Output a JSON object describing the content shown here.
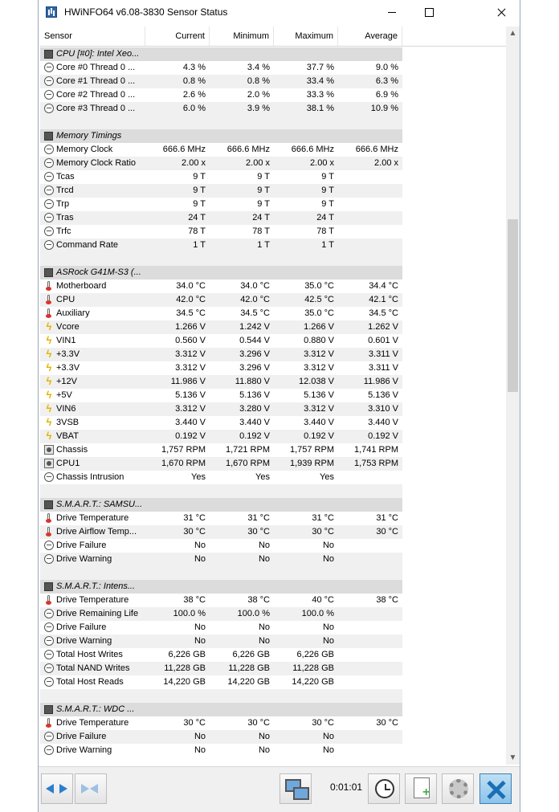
{
  "window": {
    "title": "HWiNFO64 v6.08-3830 Sensor Status"
  },
  "columns": {
    "sensor": "Sensor",
    "current": "Current",
    "minimum": "Minimum",
    "maximum": "Maximum",
    "average": "Average"
  },
  "rows": [
    {
      "kind": "group",
      "name": "CPU [#0]: Intel Xeo...",
      "icon": "chip-icon"
    },
    {
      "kind": "item",
      "icon": "clock-icon",
      "name": "Core #0 Thread 0 ...",
      "current": "4.3 %",
      "min": "3.4 %",
      "max": "37.7 %",
      "avg": "9.0 %"
    },
    {
      "kind": "item",
      "icon": "clock-icon",
      "name": "Core #1 Thread 0 ...",
      "current": "0.8 %",
      "min": "0.8 %",
      "max": "33.4 %",
      "avg": "6.3 %"
    },
    {
      "kind": "item",
      "icon": "clock-icon",
      "name": "Core #2 Thread 0 ...",
      "current": "2.6 %",
      "min": "2.0 %",
      "max": "33.3 %",
      "avg": "6.9 %"
    },
    {
      "kind": "item",
      "icon": "clock-icon",
      "name": "Core #3 Thread 0 ...",
      "current": "6.0 %",
      "min": "3.9 %",
      "max": "38.1 %",
      "avg": "10.9 %"
    },
    {
      "kind": "spacer"
    },
    {
      "kind": "group",
      "name": "Memory Timings",
      "icon": "chip-icon"
    },
    {
      "kind": "item",
      "icon": "clock-icon",
      "name": "Memory Clock",
      "current": "666.6 MHz",
      "min": "666.6 MHz",
      "max": "666.6 MHz",
      "avg": "666.6 MHz"
    },
    {
      "kind": "item",
      "icon": "clock-icon",
      "name": "Memory Clock Ratio",
      "current": "2.00 x",
      "min": "2.00 x",
      "max": "2.00 x",
      "avg": "2.00 x"
    },
    {
      "kind": "item",
      "icon": "clock-icon",
      "name": "Tcas",
      "current": "9 T",
      "min": "9 T",
      "max": "9 T",
      "avg": ""
    },
    {
      "kind": "item",
      "icon": "clock-icon",
      "name": "Trcd",
      "current": "9 T",
      "min": "9 T",
      "max": "9 T",
      "avg": ""
    },
    {
      "kind": "item",
      "icon": "clock-icon",
      "name": "Trp",
      "current": "9 T",
      "min": "9 T",
      "max": "9 T",
      "avg": ""
    },
    {
      "kind": "item",
      "icon": "clock-icon",
      "name": "Tras",
      "current": "24 T",
      "min": "24 T",
      "max": "24 T",
      "avg": ""
    },
    {
      "kind": "item",
      "icon": "clock-icon",
      "name": "Trfc",
      "current": "78 T",
      "min": "78 T",
      "max": "78 T",
      "avg": ""
    },
    {
      "kind": "item",
      "icon": "clock-icon",
      "name": "Command Rate",
      "current": "1 T",
      "min": "1 T",
      "max": "1 T",
      "avg": ""
    },
    {
      "kind": "spacer"
    },
    {
      "kind": "group",
      "name": "ASRock G41M-S3 (...",
      "icon": "chip-icon"
    },
    {
      "kind": "item",
      "icon": "thermometer-icon",
      "name": "Motherboard",
      "current": "34.0 °C",
      "min": "34.0 °C",
      "max": "35.0 °C",
      "avg": "34.4 °C"
    },
    {
      "kind": "item",
      "icon": "thermometer-icon",
      "name": "CPU",
      "current": "42.0 °C",
      "min": "42.0 °C",
      "max": "42.5 °C",
      "avg": "42.1 °C"
    },
    {
      "kind": "item",
      "icon": "thermometer-icon",
      "name": "Auxiliary",
      "current": "34.5 °C",
      "min": "34.5 °C",
      "max": "35.0 °C",
      "avg": "34.5 °C"
    },
    {
      "kind": "item",
      "icon": "voltage-icon",
      "name": "Vcore",
      "current": "1.266 V",
      "min": "1.242 V",
      "max": "1.266 V",
      "avg": "1.262 V"
    },
    {
      "kind": "item",
      "icon": "voltage-icon",
      "name": "VIN1",
      "current": "0.560 V",
      "min": "0.544 V",
      "max": "0.880 V",
      "avg": "0.601 V"
    },
    {
      "kind": "item",
      "icon": "voltage-icon",
      "name": "+3.3V",
      "current": "3.312 V",
      "min": "3.296 V",
      "max": "3.312 V",
      "avg": "3.311 V"
    },
    {
      "kind": "item",
      "icon": "voltage-icon",
      "name": "+3.3V",
      "current": "3.312 V",
      "min": "3.296 V",
      "max": "3.312 V",
      "avg": "3.311 V"
    },
    {
      "kind": "item",
      "icon": "voltage-icon",
      "name": "+12V",
      "current": "11.986 V",
      "min": "11.880 V",
      "max": "12.038 V",
      "avg": "11.986 V"
    },
    {
      "kind": "item",
      "icon": "voltage-icon",
      "name": "+5V",
      "current": "5.136 V",
      "min": "5.136 V",
      "max": "5.136 V",
      "avg": "5.136 V"
    },
    {
      "kind": "item",
      "icon": "voltage-icon",
      "name": "VIN6",
      "current": "3.312 V",
      "min": "3.280 V",
      "max": "3.312 V",
      "avg": "3.310 V"
    },
    {
      "kind": "item",
      "icon": "voltage-icon",
      "name": "3VSB",
      "current": "3.440 V",
      "min": "3.440 V",
      "max": "3.440 V",
      "avg": "3.440 V"
    },
    {
      "kind": "item",
      "icon": "voltage-icon",
      "name": "VBAT",
      "current": "0.192 V",
      "min": "0.192 V",
      "max": "0.192 V",
      "avg": "0.192 V"
    },
    {
      "kind": "item",
      "icon": "fan-icon",
      "name": "Chassis",
      "current": "1,757 RPM",
      "min": "1,721 RPM",
      "max": "1,757 RPM",
      "avg": "1,741 RPM"
    },
    {
      "kind": "item",
      "icon": "fan-icon",
      "name": "CPU1",
      "current": "1,670 RPM",
      "min": "1,670 RPM",
      "max": "1,939 RPM",
      "avg": "1,753 RPM"
    },
    {
      "kind": "item",
      "icon": "clock-icon",
      "name": "Chassis Intrusion",
      "current": "Yes",
      "min": "Yes",
      "max": "Yes",
      "avg": ""
    },
    {
      "kind": "spacer"
    },
    {
      "kind": "group",
      "name": "S.M.A.R.T.: SAMSU...",
      "icon": "chip-icon"
    },
    {
      "kind": "item",
      "icon": "thermometer-icon",
      "name": "Drive Temperature",
      "current": "31 °C",
      "min": "31 °C",
      "max": "31 °C",
      "avg": "31 °C"
    },
    {
      "kind": "item",
      "icon": "thermometer-icon",
      "name": "Drive Airflow Temp...",
      "current": "30 °C",
      "min": "30 °C",
      "max": "30 °C",
      "avg": "30 °C"
    },
    {
      "kind": "item",
      "icon": "clock-icon",
      "name": "Drive Failure",
      "current": "No",
      "min": "No",
      "max": "No",
      "avg": ""
    },
    {
      "kind": "item",
      "icon": "clock-icon",
      "name": "Drive Warning",
      "current": "No",
      "min": "No",
      "max": "No",
      "avg": ""
    },
    {
      "kind": "spacer"
    },
    {
      "kind": "group",
      "name": "S.M.A.R.T.: Intens...",
      "icon": "chip-icon"
    },
    {
      "kind": "item",
      "icon": "thermometer-icon",
      "name": "Drive Temperature",
      "current": "38 °C",
      "min": "38 °C",
      "max": "40 °C",
      "avg": "38 °C"
    },
    {
      "kind": "item",
      "icon": "clock-icon",
      "name": "Drive Remaining Life",
      "current": "100.0 %",
      "min": "100.0 %",
      "max": "100.0 %",
      "avg": ""
    },
    {
      "kind": "item",
      "icon": "clock-icon",
      "name": "Drive Failure",
      "current": "No",
      "min": "No",
      "max": "No",
      "avg": ""
    },
    {
      "kind": "item",
      "icon": "clock-icon",
      "name": "Drive Warning",
      "current": "No",
      "min": "No",
      "max": "No",
      "avg": ""
    },
    {
      "kind": "item",
      "icon": "clock-icon",
      "name": "Total Host Writes",
      "current": "6,226 GB",
      "min": "6,226 GB",
      "max": "6,226 GB",
      "avg": ""
    },
    {
      "kind": "item",
      "icon": "clock-icon",
      "name": "Total NAND Writes",
      "current": "11,228 GB",
      "min": "11,228 GB",
      "max": "11,228 GB",
      "avg": ""
    },
    {
      "kind": "item",
      "icon": "clock-icon",
      "name": "Total Host Reads",
      "current": "14,220 GB",
      "min": "14,220 GB",
      "max": "14,220 GB",
      "avg": ""
    },
    {
      "kind": "spacer"
    },
    {
      "kind": "group",
      "name": "S.M.A.R.T.: WDC ...",
      "icon": "chip-icon"
    },
    {
      "kind": "item",
      "icon": "thermometer-icon",
      "name": "Drive Temperature",
      "current": "30 °C",
      "min": "30 °C",
      "max": "30 °C",
      "avg": "30 °C"
    },
    {
      "kind": "item",
      "icon": "clock-icon",
      "name": "Drive Failure",
      "current": "No",
      "min": "No",
      "max": "No",
      "avg": ""
    },
    {
      "kind": "item",
      "icon": "clock-icon",
      "name": "Drive Warning",
      "current": "No",
      "min": "No",
      "max": "No",
      "avg": ""
    }
  ],
  "toolbar": {
    "timer": "0:01:01"
  },
  "colors": {
    "accent": "#2a7ed1",
    "group_row": "#dcdcdc",
    "alt_row": "#f0f0f0"
  }
}
